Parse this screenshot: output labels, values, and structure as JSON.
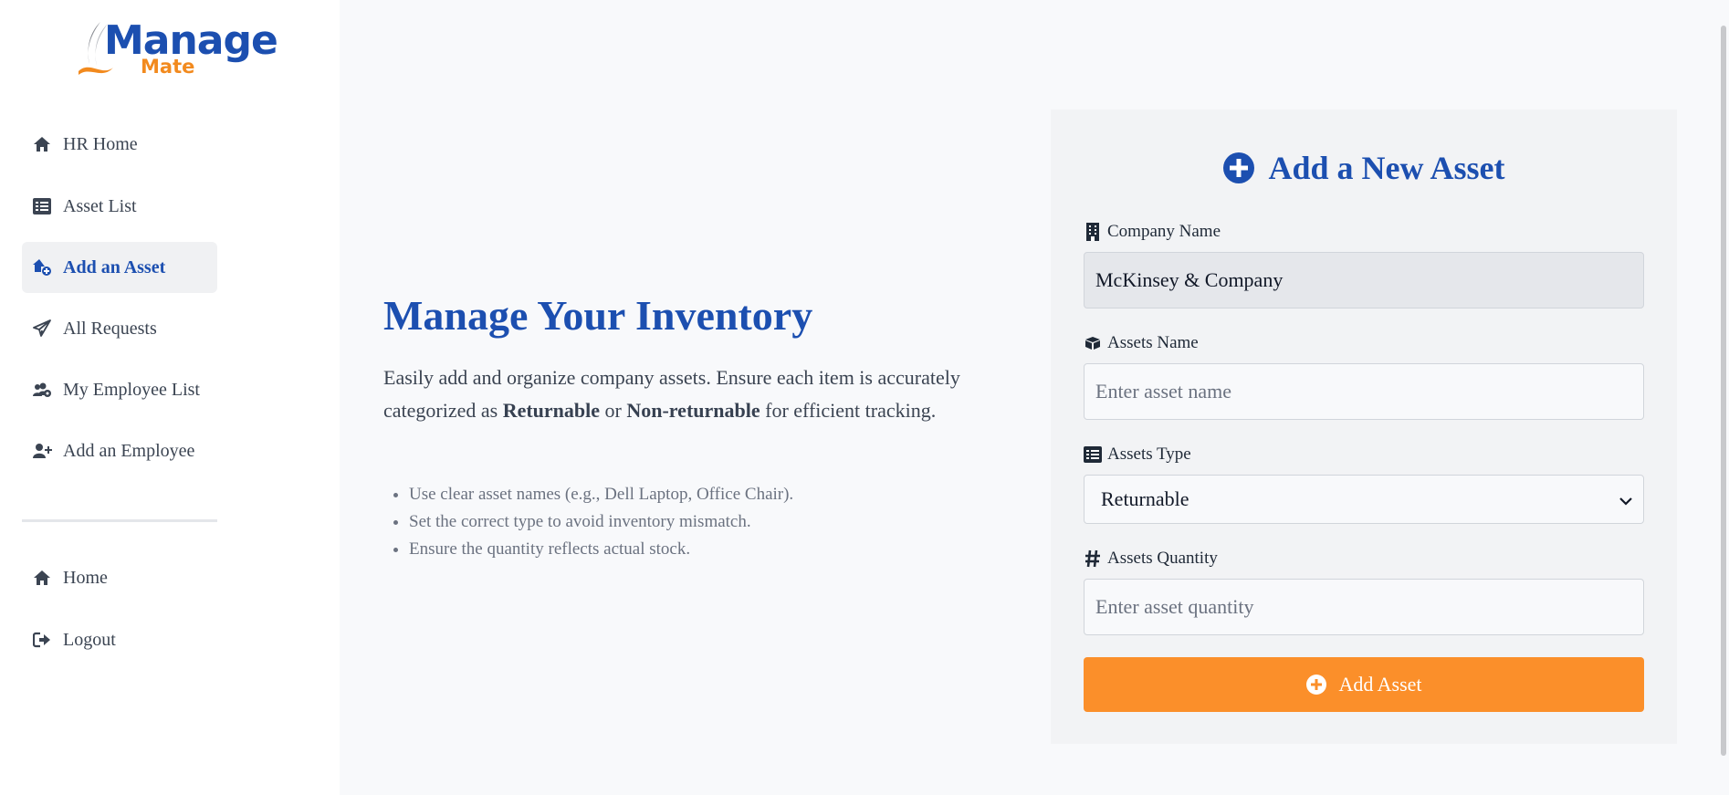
{
  "logo": {
    "main": "Manage",
    "sub": "Mate"
  },
  "sidebar": {
    "items": [
      {
        "label": "HR Home",
        "icon": "home-icon"
      },
      {
        "label": "Asset List",
        "icon": "list-icon"
      },
      {
        "label": "Add an Asset",
        "icon": "add-asset-icon",
        "active": true
      },
      {
        "label": "All Requests",
        "icon": "paper-plane-icon"
      },
      {
        "label": "My Employee List",
        "icon": "users-gear-icon"
      },
      {
        "label": "Add an Employee",
        "icon": "user-plus-icon"
      }
    ],
    "bottom_items": [
      {
        "label": "Home",
        "icon": "home-icon"
      },
      {
        "label": "Logout",
        "icon": "logout-icon"
      }
    ]
  },
  "hero": {
    "title": "Manage Your Inventory",
    "text_before": "Easily add and organize company assets. Ensure each item is accurately categorized as ",
    "bold1": "Returnable",
    "text_mid": " or ",
    "bold2": "Non-returnable",
    "text_after": " for efficient tracking.",
    "tips": [
      "Use clear asset names (e.g., Dell Laptop, Office Chair).",
      "Set the correct type to avoid inventory mismatch.",
      "Ensure the quantity reflects actual stock."
    ]
  },
  "form": {
    "title": "Add a New Asset",
    "company_label": "Company Name",
    "company_value": "McKinsey & Company",
    "asset_name_label": "Assets Name",
    "asset_name_placeholder": "Enter asset name",
    "asset_type_label": "Assets Type",
    "asset_type_value": "Returnable",
    "asset_qty_label": "Assets Quantity",
    "asset_qty_placeholder": "Enter asset quantity",
    "submit_label": "Add Asset"
  },
  "colors": {
    "brand_blue": "#1c4fb0",
    "accent_orange": "#fb8f2a"
  }
}
